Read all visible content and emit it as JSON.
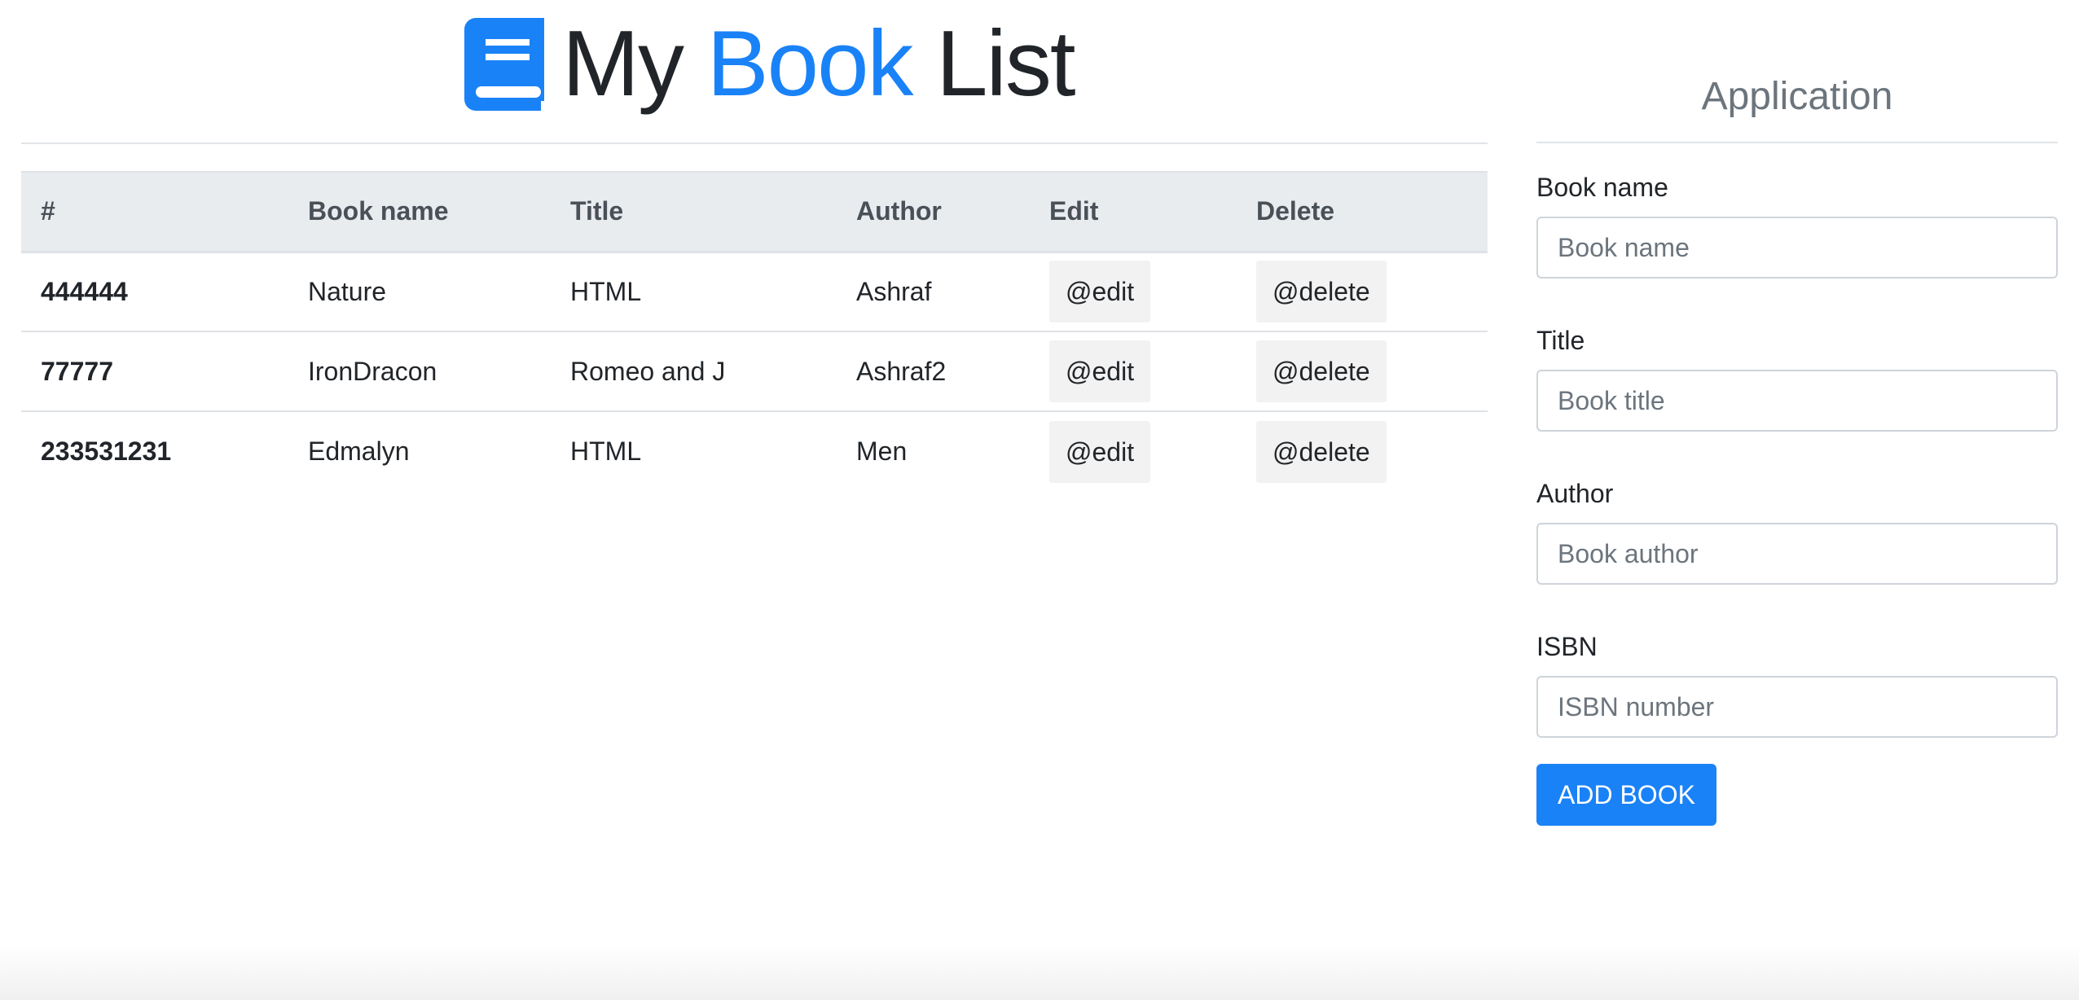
{
  "header": {
    "title_part1": "My ",
    "title_accent": "Book",
    "title_part2": " List",
    "logo_icon": "book-icon",
    "accent_color": "#1a82f7"
  },
  "table": {
    "headers": [
      "#",
      "Book name",
      "Title",
      "Author",
      "Edit",
      "Delete"
    ],
    "rows": [
      {
        "isbn": "444444",
        "book_name": "Nature",
        "title": "HTML",
        "author": "Ashraf",
        "edit": "@edit",
        "delete": "@delete"
      },
      {
        "isbn": "77777",
        "book_name": "IronDracon",
        "title": "Romeo and J",
        "author": "Ashraf2",
        "edit": "@edit",
        "delete": "@delete"
      },
      {
        "isbn": "233531231",
        "book_name": "Edmalyn",
        "title": "HTML",
        "author": "Men",
        "edit": "@edit",
        "delete": "@delete"
      }
    ]
  },
  "form": {
    "heading": "Application",
    "book_name": {
      "label": "Book name",
      "placeholder": "Book name",
      "value": ""
    },
    "title": {
      "label": "Title",
      "placeholder": "Book title",
      "value": ""
    },
    "author": {
      "label": "Author",
      "placeholder": "Book author",
      "value": ""
    },
    "isbn": {
      "label": "ISBN",
      "placeholder": "ISBN number",
      "value": ""
    },
    "submit_label": "ADD BOOK",
    "button_color": "#1a82f7"
  }
}
